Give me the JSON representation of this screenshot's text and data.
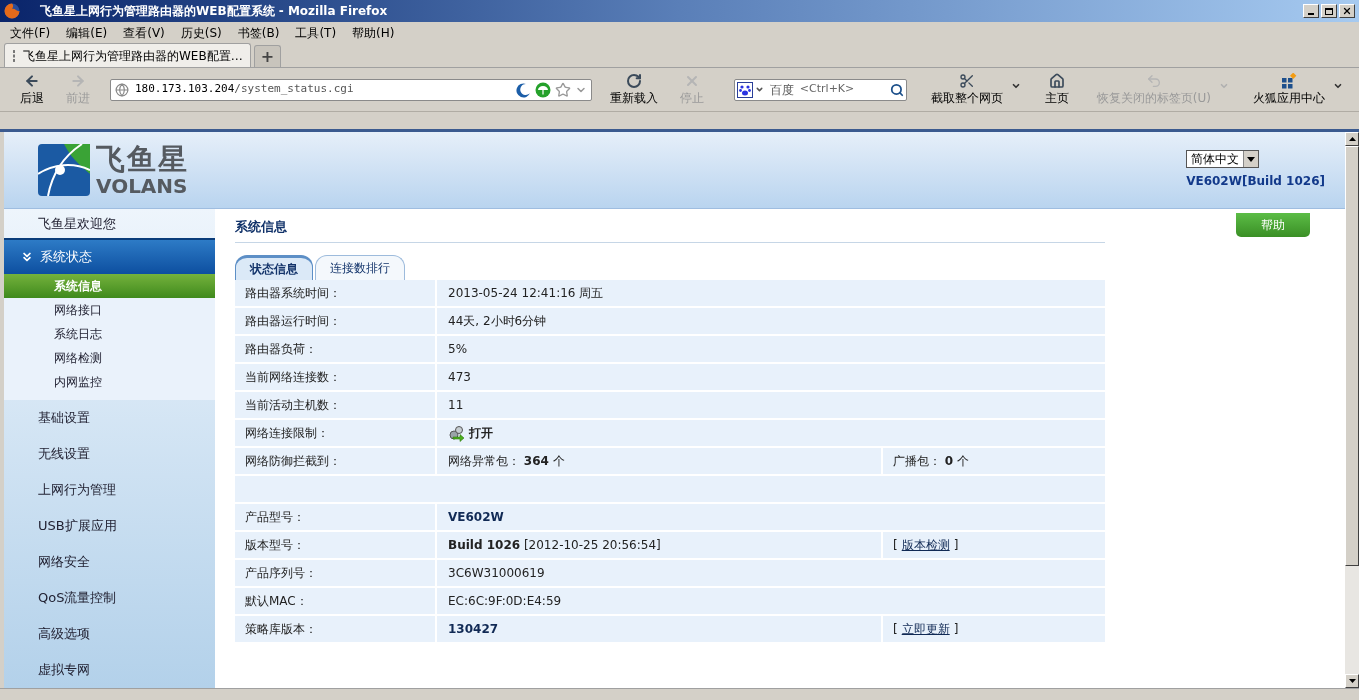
{
  "window": {
    "title": "飞鱼星上网行为管理路由器的WEB配置系统 - Mozilla Firefox"
  },
  "menu": [
    "文件(F)",
    "编辑(E)",
    "查看(V)",
    "历史(S)",
    "书签(B)",
    "工具(T)",
    "帮助(H)"
  ],
  "browser_tab": {
    "title": "飞鱼星上网行为管理路由器的WEB配置…",
    "new_tab": "+"
  },
  "nav_left": [
    {
      "kind": "back",
      "label": "后退",
      "disabled": false
    },
    {
      "kind": "forward",
      "label": "前进",
      "disabled": true
    }
  ],
  "address": {
    "host": "180.173.103.204",
    "path": "/system_status.cgi"
  },
  "nav_mid": [
    {
      "kind": "reload",
      "label": "重新载入",
      "disabled": false
    },
    {
      "kind": "stop",
      "label": "停止",
      "disabled": true
    }
  ],
  "search": {
    "engine": "百度",
    "placeholder": "<Ctrl+K>"
  },
  "nav_right": [
    {
      "kind": "screenshot",
      "label": "截取整个网页",
      "disabled": false,
      "dropdown": true
    },
    {
      "kind": "home",
      "label": "主页",
      "disabled": false,
      "dropdown": false
    },
    {
      "kind": "restore",
      "label": "恢复关闭的标签页(U)",
      "disabled": true,
      "dropdown": true
    },
    {
      "kind": "apps",
      "label": "火狐应用中心",
      "disabled": false,
      "dropdown": true
    }
  ],
  "header": {
    "logo_cn": "飞鱼星",
    "logo_en": "VOLANS",
    "language": "简体中文",
    "model": "VE602W[Build 1026]"
  },
  "sidebar": {
    "welcome": "飞鱼星欢迎您",
    "items": [
      {
        "label": "系统状态",
        "expanded": true,
        "children": [
          {
            "label": "系统信息",
            "selected": true
          },
          {
            "label": "网络接口",
            "selected": false
          },
          {
            "label": "系统日志",
            "selected": false
          },
          {
            "label": "网络检测",
            "selected": false
          },
          {
            "label": "内网监控",
            "selected": false
          }
        ]
      },
      {
        "label": "基础设置",
        "expanded": false
      },
      {
        "label": "无线设置",
        "expanded": false
      },
      {
        "label": "上网行为管理",
        "expanded": false
      },
      {
        "label": "USB扩展应用",
        "expanded": false
      },
      {
        "label": "网络安全",
        "expanded": false
      },
      {
        "label": "QoS流量控制",
        "expanded": false
      },
      {
        "label": "高级选项",
        "expanded": false
      },
      {
        "label": "虚拟专网",
        "expanded": false
      }
    ]
  },
  "help_button": "帮助",
  "section_title": "系统信息",
  "tabs": [
    {
      "label": "状态信息",
      "selected": true
    },
    {
      "label": "连接数排行",
      "selected": false
    }
  ],
  "rows": [
    {
      "kind": "text",
      "label": "路由器系统时间：",
      "value": "2013-05-24 12:41:16 周五"
    },
    {
      "kind": "text",
      "label": "路由器运行时间：",
      "value": "44天, 2小时6分钟"
    },
    {
      "kind": "text",
      "label": "路由器负荷：",
      "value": "5%"
    },
    {
      "kind": "text",
      "label": "当前网络连接数：",
      "value": "473"
    },
    {
      "kind": "text",
      "label": "当前活动主机数：",
      "value": "11"
    },
    {
      "kind": "status",
      "label": "网络连接限制：",
      "value": "打开"
    },
    {
      "kind": "split",
      "label": "网络防御拦截到：",
      "value": "网络异常包： **364** 个",
      "extra": "广播包： **0** 个"
    },
    {
      "kind": "spacer"
    },
    {
      "kind": "bold",
      "label": "产品型号：",
      "value": "VE602W"
    },
    {
      "kind": "text",
      "label": "版本型号：",
      "value": "**Build 1026** [2012-10-25 20:56:54]",
      "link": {
        "before": "[",
        "text": "版本检测",
        "after": "]"
      }
    },
    {
      "kind": "text",
      "label": "产品序列号：",
      "value": "3C6W31000619"
    },
    {
      "kind": "text",
      "label": "默认MAC：",
      "value": "EC:6C:9F:0D:E4:59"
    },
    {
      "kind": "bold",
      "label": "策略库版本：",
      "value": "130427",
      "link": {
        "before": "[",
        "text": "立即更新",
        "after": "]"
      }
    }
  ]
}
